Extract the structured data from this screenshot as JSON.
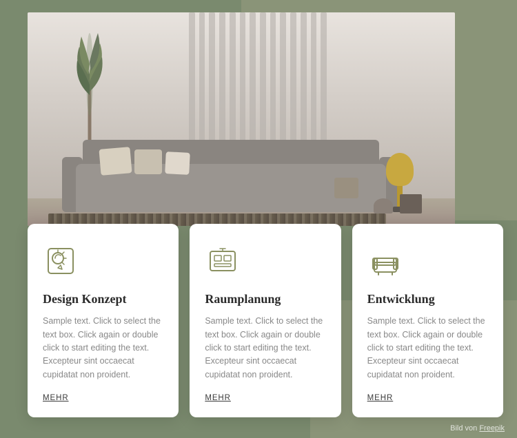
{
  "hero": {
    "alt": "Modern interior room with sofa and plants"
  },
  "cards": [
    {
      "id": "design-konzept",
      "icon_name": "design-konzept-icon",
      "title": "Design Konzept",
      "text": "Sample text. Click to select the text box. Click again or double click to start editing the text. Excepteur sint occaecat cupidatat non proident.",
      "link": "MEHR"
    },
    {
      "id": "raumplanung",
      "icon_name": "raumplanung-icon",
      "title": "Raumplanung",
      "text": "Sample text. Click to select the text box. Click again or double click to start editing the text. Excepteur sint occaecat cupidatat non proident.",
      "link": "MEHR"
    },
    {
      "id": "entwicklung",
      "icon_name": "entwicklung-icon",
      "title": "Entwicklung",
      "text": "Sample text. Click to select the text box. Click again or double click to start editing the text. Excepteur sint occaecat cupidatat non proident.",
      "link": "MEHR"
    }
  ],
  "credit": {
    "prefix": "Bild von",
    "link_text": "Freepik"
  }
}
